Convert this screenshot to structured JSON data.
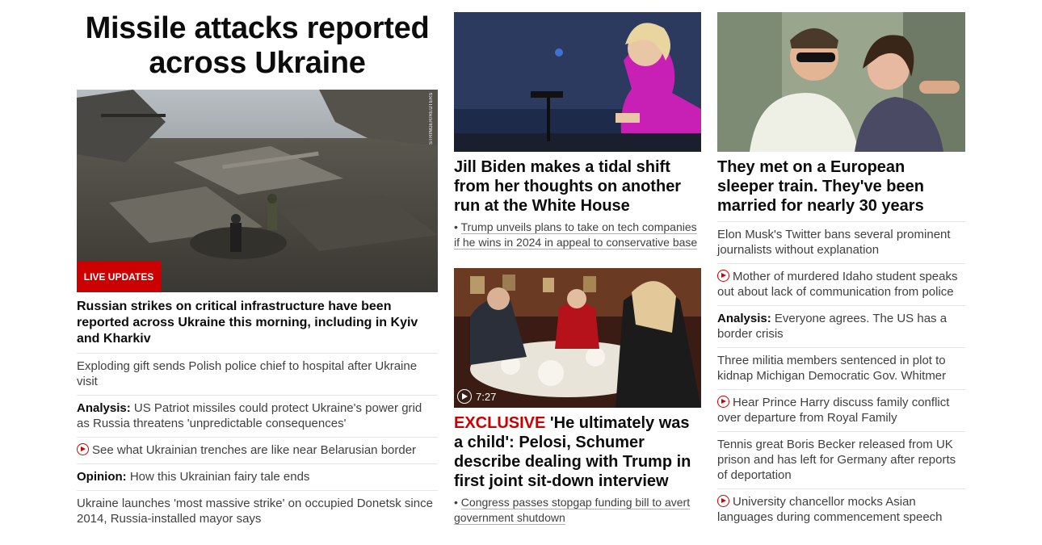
{
  "main": {
    "headline": "Missile attacks reported across Ukraine",
    "badge": "LIVE UPDATES",
    "photo_credit": "STRINGER/REUTERS",
    "summary": "Russian strikes on critical infrastructure have been reported across Ukraine this morning, including in Kyiv and Kharkiv",
    "links": [
      {
        "prefix": "",
        "text": "Exploding gift sends Polish police chief to hospital after Ukraine visit",
        "video": false
      },
      {
        "prefix": "Analysis:",
        "text": " US Patriot missiles could protect Ukraine's power grid as Russia threatens 'unpredictable consequences'",
        "video": false
      },
      {
        "prefix": "",
        "text": "See what Ukrainian trenches are like near Belarusian border",
        "video": true
      },
      {
        "prefix": "Opinion:",
        "text": " How this Ukrainian fairy tale ends",
        "video": false
      },
      {
        "prefix": "",
        "text": "Ukraine launches 'most massive strike' on occupied Donetsk since 2014, Russia-installed mayor says",
        "video": false
      }
    ]
  },
  "middle": {
    "story1": {
      "headline": "Jill Biden makes a tidal shift from her thoughts on another run at the White House",
      "related": "Trump unveils plans to take on tech companies if he wins in 2024 in appeal to conservative base"
    },
    "story2": {
      "video_duration": "7:27",
      "label": "EXCLUSIVE",
      "headline": " 'He ultimately was a child': Pelosi, Schumer describe dealing with Trump in first joint sit-down interview",
      "related": "Congress passes stopgap funding bill to avert government shutdown"
    }
  },
  "right": {
    "headline": "They met on a European sleeper train. They've been married for nearly 30 years",
    "links": [
      {
        "prefix": "",
        "text": "Elon Musk's Twitter bans several prominent journalists without explanation",
        "video": false
      },
      {
        "prefix": "",
        "text": "Mother of murdered Idaho student speaks out about lack of communication from police",
        "video": true
      },
      {
        "prefix": "Analysis:",
        "text": " Everyone agrees. The US has a border crisis",
        "video": false
      },
      {
        "prefix": "",
        "text": "Three militia members sentenced in plot to kidnap Michigan Democratic Gov. Whitmer",
        "video": false
      },
      {
        "prefix": "",
        "text": "Hear Prince Harry discuss family conflict over departure from Royal Family",
        "video": true
      },
      {
        "prefix": "",
        "text": "Tennis great Boris Becker released from UK prison and has left for Germany after reports of deportation",
        "video": false
      },
      {
        "prefix": "",
        "text": "University chancellor mocks Asian languages during commencement speech",
        "video": true
      }
    ]
  },
  "colors": {
    "accent": "#cc0000",
    "text": "#0c0c0c",
    "muted": "#404040",
    "divider": "#e6e6e6"
  },
  "icons": {
    "video": "play-circle-icon"
  }
}
